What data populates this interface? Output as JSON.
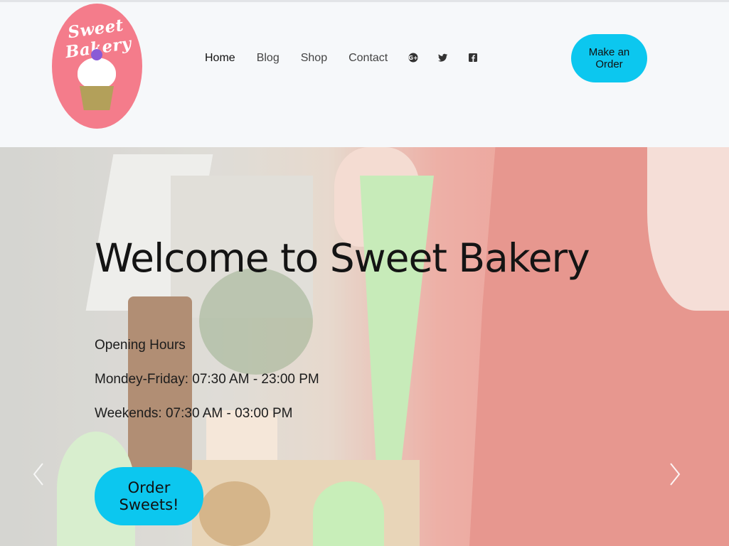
{
  "brand": {
    "logo_text": "Sweet Bakery"
  },
  "nav": {
    "items": [
      {
        "label": "Home",
        "active": true
      },
      {
        "label": "Blog",
        "active": false
      },
      {
        "label": "Shop",
        "active": false
      },
      {
        "label": "Contact",
        "active": false
      }
    ]
  },
  "social": {
    "icons": [
      "google-plus-icon",
      "twitter-icon",
      "facebook-icon"
    ]
  },
  "header": {
    "order_button_label": "Make an Order"
  },
  "hero": {
    "title": "Welcome to Sweet Bakery",
    "hours_heading": "Opening Hours",
    "hours_weekdays": "Mondey-Friday: 07:30 AM - 23:00 PM",
    "hours_weekends": "Weekends: 07:30 AM - 03:00 PM",
    "cta_label": "Order Sweets!"
  },
  "colors": {
    "accent": "#0cc7ef",
    "logo_pink": "#f47c8b",
    "header_bg": "#f6f8fa"
  }
}
